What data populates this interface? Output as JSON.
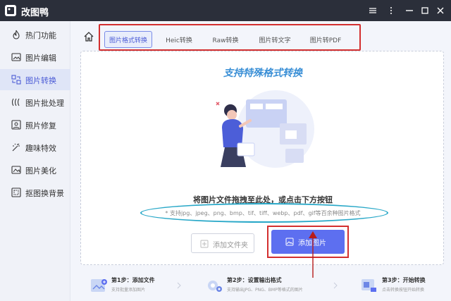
{
  "app": {
    "title": "改图鸭"
  },
  "sidebar": {
    "items": [
      {
        "label": "热门功能",
        "icon": "fire-icon"
      },
      {
        "label": "图片编辑",
        "icon": "image-edit-icon"
      },
      {
        "label": "图片转换",
        "icon": "convert-icon",
        "active": true
      },
      {
        "label": "图片批处理",
        "icon": "batch-icon"
      },
      {
        "label": "照片修复",
        "icon": "repair-icon"
      },
      {
        "label": "趣味特效",
        "icon": "magic-icon"
      },
      {
        "label": "图片美化",
        "icon": "beautify-icon"
      },
      {
        "label": "抠图换背景",
        "icon": "cutout-icon"
      }
    ]
  },
  "tabs": [
    {
      "label": "图片格式转换",
      "active": true
    },
    {
      "label": "Heic转换"
    },
    {
      "label": "Raw转换"
    },
    {
      "label": "图片转文字"
    },
    {
      "label": "图片转PDF"
    }
  ],
  "dropzone": {
    "headline": "支持特殊格式转换",
    "hint": "将图片文件拖拽至此处，或点击下方按钮",
    "formats": "* 支持jpg、jpeg、png、bmp、tif、tiff、webp、pdf、gif等百余种图片格式",
    "add_folder_label": "添加文件夹",
    "add_image_label": "添加图片"
  },
  "steps": [
    {
      "title": "第1步：添加文件",
      "desc": "支持批量添加图片"
    },
    {
      "title": "第2步：设置输出格式",
      "desc": "支持输出JPG、PNG、BMP等格式的图片"
    },
    {
      "title": "第3步：开始转换",
      "desc": "点击转换按钮开始转换"
    }
  ],
  "colors": {
    "accent": "#5d6ff0",
    "annotation_red": "#d32f2f",
    "annotation_cyan": "#29a8c8",
    "titlebar": "#2b2f3a"
  }
}
